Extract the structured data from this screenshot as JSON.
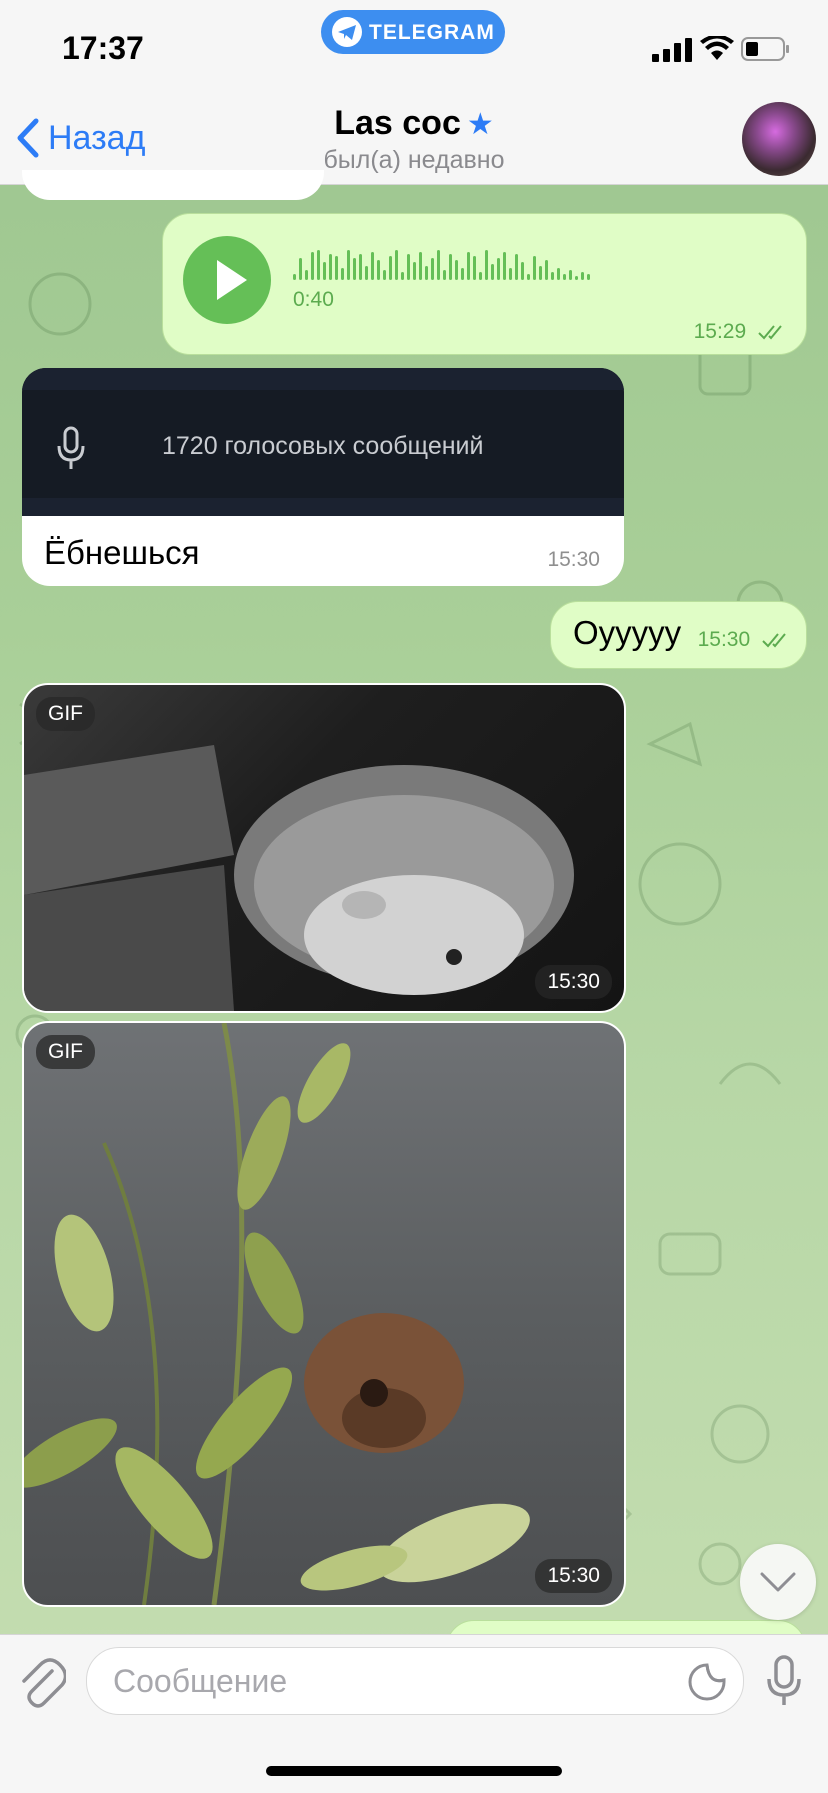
{
  "status_bar": {
    "time": "17:37",
    "pill_label": "TELEGRAM"
  },
  "header": {
    "back_label": "Назад",
    "title": "Las coc",
    "status": "был(а) недавно"
  },
  "messages": {
    "voice": {
      "duration": "0:40",
      "time": "15:29"
    },
    "link_preview": {
      "preview_text": "1720 голосовых сообщений",
      "text": "Ёбнешься",
      "time": "15:30"
    },
    "out_text": {
      "text": "Оууууу",
      "time": "15:30"
    },
    "gif1": {
      "badge": "GIF",
      "time": "15:30"
    },
    "gif2": {
      "badge": "GIF",
      "time": "15:30"
    }
  },
  "input": {
    "placeholder": "Сообщение"
  },
  "colors": {
    "accent": "#2d7cf6",
    "outgoing_bubble": "#e0fdc6",
    "voice_green": "#65bf57",
    "telegram_pill": "#3d8ef0"
  },
  "icons": [
    "telegram-plane-icon",
    "signal-icon",
    "wifi-icon",
    "battery-icon",
    "back-chevron-icon",
    "verified-star-icon",
    "play-icon",
    "double-check-icon",
    "microphone-icon",
    "attach-icon",
    "sticker-icon",
    "chevron-down-icon"
  ]
}
